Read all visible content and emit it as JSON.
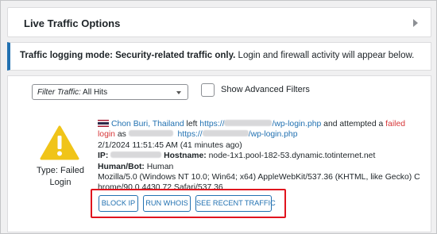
{
  "header": {
    "title": "Live Traffic Options"
  },
  "notice": {
    "bold_text": "Traffic logging mode: Security-related traffic only.",
    "text": " Login and firewall activity will appear below."
  },
  "filter": {
    "label": "Filter Traffic:",
    "selected": " All Hits",
    "advanced_label": "Show Advanced Filters"
  },
  "entry": {
    "type_label": "Type: Failed Login",
    "location": "Chon Buri, Thailand",
    "left_text": " left ",
    "url_prefix": "https://",
    "url_suffix": "/wp-login.php",
    "attempted_text": " and attempted a ",
    "failed_text": "failed",
    "login_text": "login",
    "as_text": " as ",
    "url2_prefix": "https://",
    "url2_suffix": "/wp-login.php",
    "timestamp": "2/1/2024 11:51:45 AM (41 minutes ago)",
    "ip_label": "IP:",
    "hostname_label": "Hostname:",
    "hostname": " node-1x1.pool-182-53.dynamic.totinternet.net",
    "human_label": "Human/Bot:",
    "human_value": " Human",
    "ua_line1": "Mozilla/5.0 (Windows NT 10.0; Win64; x64) AppleWebKit/537.36 (KHTML, like Gecko) C",
    "ua_line2": "hrome/90.0.4430.72 Safari/537.36"
  },
  "actions": {
    "block_ip": "BLOCK IP",
    "run_whois": "RUN WHOIS",
    "see_recent": "SEE RECENT TRAFFIC"
  },
  "colors": {
    "accent": "#2271b1",
    "failed": "#d63638",
    "warning": "#f0c419",
    "highlight_box": "#e0141e"
  },
  "icons": [
    "chevron-right-icon",
    "chevron-down-icon",
    "warning-icon",
    "thailand-flag-icon"
  ]
}
